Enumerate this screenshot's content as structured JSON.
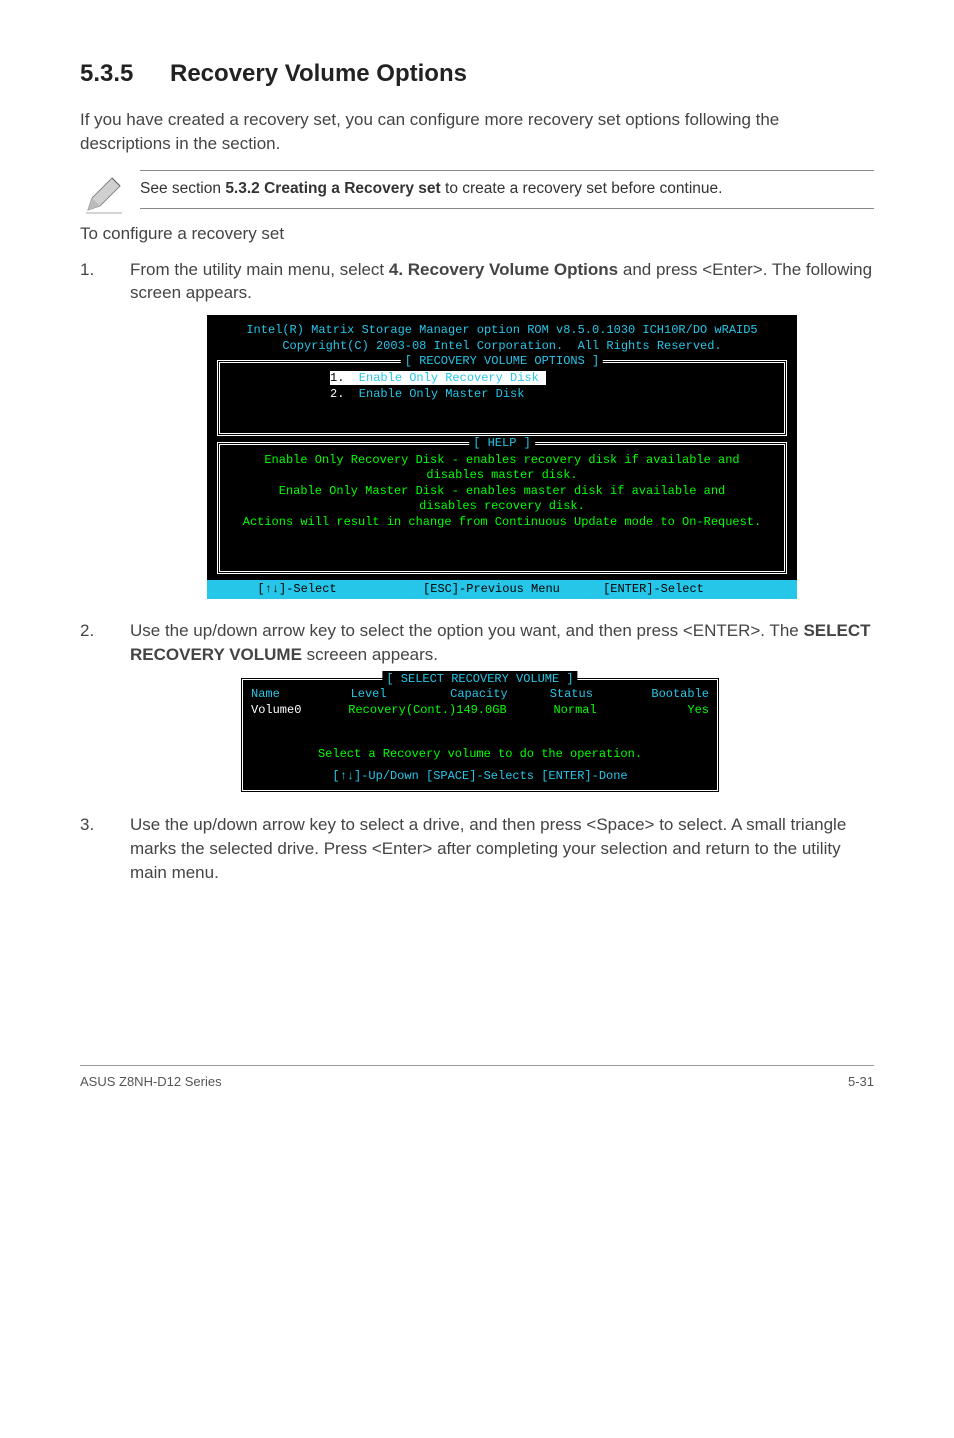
{
  "section": {
    "number": "5.3.5",
    "title": "Recovery Volume Options"
  },
  "intro": "If you have created a recovery set, you can configure more recovery set options following the descriptions in the section.",
  "note": {
    "prefix": "See section ",
    "bold": "5.3.2 Creating a Recovery set",
    "suffix": " to create a recovery set before continue."
  },
  "subhead": "To configure a recovery set",
  "steps": {
    "s1_prefix": "From the utility main menu, select ",
    "s1_bold": "4. Recovery Volume Options",
    "s1_suffix": " and press <Enter>. The following screen appears.",
    "s2_prefix": "Use the up/down arrow key to select the option you want, and then press <ENTER>. The ",
    "s2_bold": "SELECT RECOVERY VOLUME",
    "s2_suffix": " screeen appears.",
    "s3": "Use the up/down arrow key to select a drive, and then press <Space> to select. A small triangle marks the selected drive. Press <Enter> after completing your selection and return to the utility main menu."
  },
  "bios1": {
    "hdr1": "Intel(R) Matrix Storage Manager option ROM v8.5.0.1030 ICH10R/DO wRAID5",
    "hdr2": "Copyright(C) 2003-08 Intel Corporation.  All Rights Reserved.",
    "box1_title": "[ RECOVERY VOLUME OPTIONS ]",
    "opt1_num": "1.",
    "opt1_lbl": "  Enable Only Recovery Disk ",
    "opt2_num": "2.",
    "opt2_lbl": "  Enable Only Master Disk",
    "box2_title": "[ HELP ]",
    "help1": "Enable Only Recovery Disk - enables recovery disk if available and",
    "help2": "disables master disk.",
    "help3": "Enable Only Master Disk - enables master disk if available and",
    "help4": "disables recovery disk.",
    "help5": "Actions will result in change from Continuous Update mode to On-Request.",
    "footer": "       [↑↓]-Select            [ESC]-Previous Menu      [ENTER]-Select        "
  },
  "bios2": {
    "title": "[ SELECT RECOVERY VOLUME ]",
    "h_name": "Name",
    "h_level": "Level",
    "h_cap": "Capacity",
    "h_status": "Status",
    "h_boot": "Bootable",
    "d_name": "Volume0",
    "d_level": "Recovery(Cont.)",
    "d_cap": "149.0GB",
    "d_status": "Normal",
    "d_boot": "Yes",
    "msg": "Select a Recovery volume to do the operation.",
    "ft": "[↑↓]-Up/Down [SPACE]-Selects [ENTER]-Done"
  },
  "footer": {
    "left": "ASUS Z8NH-D12 Series",
    "right": "5-31"
  }
}
